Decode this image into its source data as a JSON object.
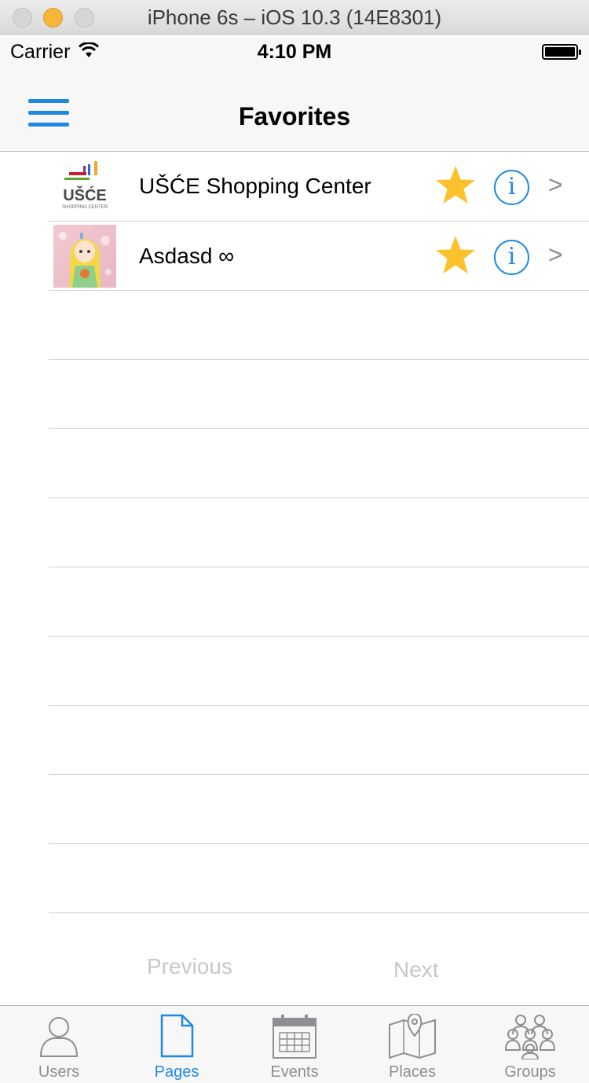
{
  "simulator": {
    "title": "iPhone 6s – iOS 10.3 (14E8301)"
  },
  "status_bar": {
    "carrier": "Carrier",
    "time": "4:10 PM"
  },
  "nav": {
    "title": "Favorites",
    "menu_icon": "hamburger-menu-icon"
  },
  "list": {
    "items": [
      {
        "label": "UŠĆE Shopping Center",
        "thumb_text": "UŠĆE",
        "thumb_subtext": "SHOPPING CENTER",
        "favorite": true
      },
      {
        "label": "Asdasd ∞",
        "favorite": true
      }
    ],
    "info_glyph": "i",
    "chevron_glyph": ">"
  },
  "pager": {
    "previous": "Previous",
    "next": "Next"
  },
  "tabs": [
    {
      "label": "Users",
      "icon": "user-icon",
      "active": false
    },
    {
      "label": "Pages",
      "icon": "page-icon",
      "active": true
    },
    {
      "label": "Events",
      "icon": "calendar-icon",
      "active": false
    },
    {
      "label": "Places",
      "icon": "map-icon",
      "active": false
    },
    {
      "label": "Groups",
      "icon": "group-icon",
      "active": false
    }
  ],
  "colors": {
    "accent": "#1e88e5",
    "star": "#fcc22d",
    "inactive": "#8e8e93",
    "disabled": "#c7c7cc"
  }
}
